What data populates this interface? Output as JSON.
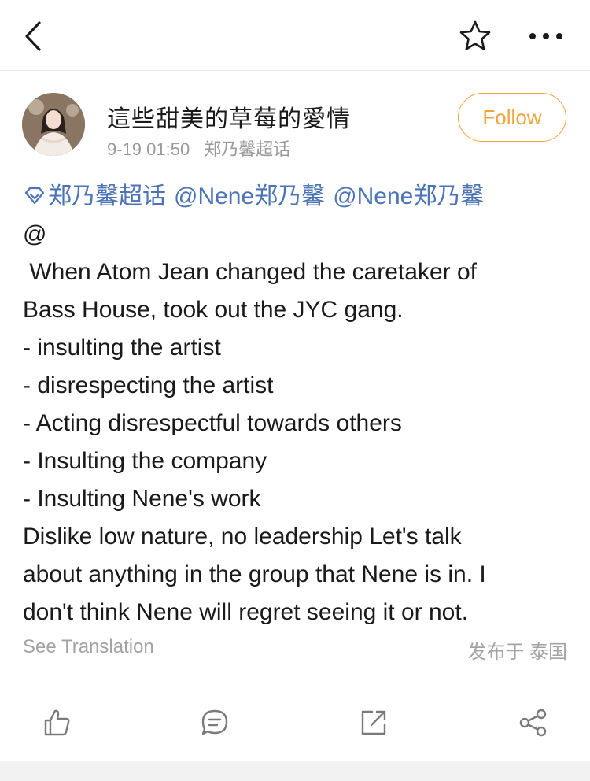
{
  "nav": {
    "back_icon": "chevron-left-icon",
    "favorite_icon": "star-outline-icon",
    "more_icon": "more-horizontal-icon"
  },
  "author": {
    "name": "這些甜美的草莓的愛情",
    "time": "9-19 01:50",
    "source": "郑乃馨超话",
    "follow_label": "Follow"
  },
  "post": {
    "tags": [
      "郑乃馨超话",
      "@Nene郑乃馨",
      "@Nene郑乃馨"
    ],
    "lines": [
      "@",
      " When Atom Jean changed the caretaker of",
      "Bass House, took out the JYC gang.",
      "- insulting the artist",
      "- disrespecting the artist",
      "- Acting disrespectful towards others",
      "- Insulting the company",
      "- Insulting Nene's work",
      "Dislike low nature, no leadership Let's talk",
      "about anything in the group that Nene is in. I",
      "don't think Nene will regret seeing it or not."
    ],
    "see_translation_label": "See Translation",
    "location": "发布于 泰国"
  },
  "actions": {
    "like_icon": "thumbs-up-icon",
    "comment_icon": "comment-icon",
    "repost_icon": "repost-icon",
    "share_icon": "share-icon"
  },
  "colors": {
    "accent_orange": "#f1a33c",
    "link_blue": "#4a73b8",
    "muted_gray": "#9a9a9a",
    "text": "#1a1a1a"
  }
}
